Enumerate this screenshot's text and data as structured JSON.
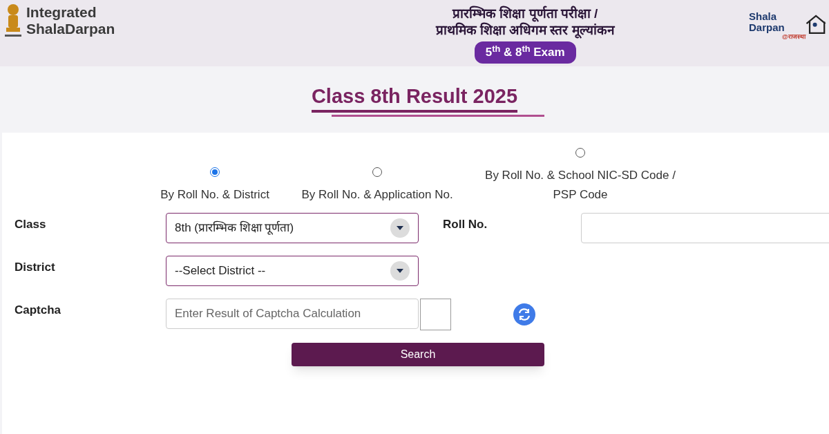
{
  "header": {
    "logo_left": {
      "first": "Integrated",
      "second": "ShalaDarpan"
    },
    "heading_lines": [
      "प्रारम्भिक शिक्षा पूर्णता परीक्षा /",
      "प्राथमिक शिक्षा अधिगम स्तर मूल्यांकन"
    ],
    "exam_badge": "5$^{th}$ & 8$^{th}$ Exam",
    "logo_right": {
      "first": "Shala",
      "second": "Darpan",
      "tagline": "@राजस्था"
    }
  },
  "title": "Class 8th Result 2025",
  "search_modes": [
    {
      "label": "By Roll No. & District",
      "selected": true
    },
    {
      "label": "By Roll No. & Application No.",
      "selected": false
    },
    {
      "label": "By Roll No. & School NIC-SD Code / PSP Code",
      "selected": false
    }
  ],
  "form": {
    "class": {
      "label": "Class",
      "value": "8th (प्रारम्भिक शिक्षा पूर्णता)"
    },
    "roll_no": {
      "label": "Roll No."
    },
    "district": {
      "label": "District",
      "value": "--Select District --"
    },
    "captcha": {
      "label": "Captcha",
      "placeholder": "Enter Result of Captcha Calculation"
    },
    "search_button": "Search"
  }
}
